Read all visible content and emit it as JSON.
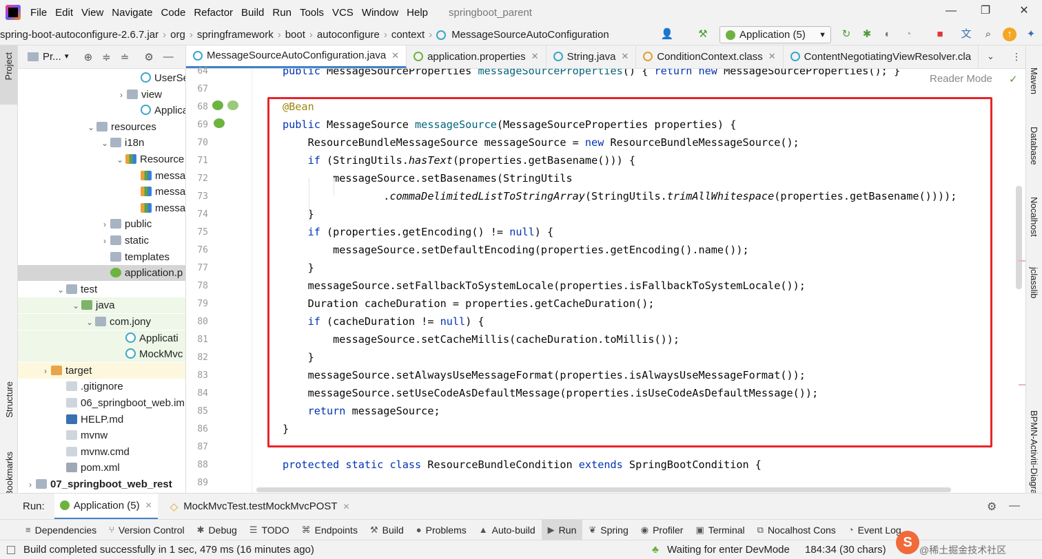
{
  "menubar": {
    "items": [
      "File",
      "Edit",
      "View",
      "Navigate",
      "Code",
      "Refactor",
      "Build",
      "Run",
      "Tools",
      "VCS",
      "Window",
      "Help"
    ],
    "project_title": "springboot_parent"
  },
  "breadcrumb": {
    "items": [
      "spring-boot-autoconfigure-2.6.7.jar",
      "org",
      "springframework",
      "boot",
      "autoconfigure",
      "context",
      "MessageSourceAutoConfiguration"
    ]
  },
  "toolbar": {
    "run_config": "Application (5)"
  },
  "left_strip": {
    "project": "Project",
    "structure": "Structure",
    "bookmarks": "Bookmarks"
  },
  "right_strip": {
    "maven": "Maven",
    "database": "Database",
    "nocalhost": "Nocalhost",
    "jclasslib": "jclasslib",
    "bpmn": "BPMN-Activiti-Diagram"
  },
  "project_panel": {
    "header": "Pr...",
    "tree": [
      {
        "label": "UserSe",
        "indent": 178,
        "icon": "class",
        "arrow": ""
      },
      {
        "label": "view",
        "indent": 158,
        "icon": "folder",
        "arrow": "›"
      },
      {
        "label": "Applicati",
        "indent": 178,
        "icon": "class",
        "arrow": ""
      },
      {
        "label": "resources",
        "indent": 114,
        "icon": "folder",
        "arrow": "⌄"
      },
      {
        "label": "i18n",
        "indent": 134,
        "icon": "folder",
        "arrow": "⌄"
      },
      {
        "label": "Resource",
        "indent": 156,
        "icon": "props",
        "arrow": "⌄"
      },
      {
        "label": "messa",
        "indent": 178,
        "icon": "props",
        "arrow": ""
      },
      {
        "label": "messa",
        "indent": 178,
        "icon": "props",
        "arrow": ""
      },
      {
        "label": "messa",
        "indent": 178,
        "icon": "props",
        "arrow": ""
      },
      {
        "label": "public",
        "indent": 134,
        "icon": "folder",
        "arrow": "›"
      },
      {
        "label": "static",
        "indent": 134,
        "icon": "folder",
        "arrow": "›"
      },
      {
        "label": "templates",
        "indent": 134,
        "icon": "folder",
        "arrow": ""
      },
      {
        "label": "application.p",
        "indent": 134,
        "icon": "spring",
        "arrow": ""
      },
      {
        "label": "test",
        "indent": 70,
        "icon": "folder",
        "arrow": "⌄"
      },
      {
        "label": "java",
        "indent": 92,
        "icon": "greenfolder",
        "arrow": "⌄"
      },
      {
        "label": "com.jony",
        "indent": 112,
        "icon": "folder",
        "arrow": "⌄"
      },
      {
        "label": "Applicati",
        "indent": 156,
        "icon": "class",
        "arrow": ""
      },
      {
        "label": "MockMvc",
        "indent": 156,
        "icon": "class",
        "arrow": ""
      },
      {
        "label": "target",
        "indent": 48,
        "icon": "orangefolder",
        "arrow": "›"
      },
      {
        "label": ".gitignore",
        "indent": 70,
        "icon": "file",
        "arrow": ""
      },
      {
        "label": "06_springboot_web.im",
        "indent": 70,
        "icon": "file",
        "arrow": ""
      },
      {
        "label": "HELP.md",
        "indent": 70,
        "icon": "md",
        "arrow": ""
      },
      {
        "label": "mvnw",
        "indent": 70,
        "icon": "file",
        "arrow": ""
      },
      {
        "label": "mvnw.cmd",
        "indent": 70,
        "icon": "file",
        "arrow": ""
      },
      {
        "label": "pom.xml",
        "indent": 70,
        "icon": "mvn",
        "arrow": ""
      },
      {
        "label": "07_springboot_web_rest",
        "indent": 26,
        "icon": "folder",
        "arrow": "›"
      }
    ]
  },
  "editor_tabs": [
    {
      "label": "MessageSourceAutoConfiguration.java",
      "active": true,
      "color": "#3aa6c8"
    },
    {
      "label": "application.properties",
      "active": false,
      "color": "#6db33f"
    },
    {
      "label": "String.java",
      "active": false,
      "color": "#3aa6c8"
    },
    {
      "label": "ConditionContext.class",
      "active": false,
      "color": "#e0a030"
    },
    {
      "label": "ContentNegotiatingViewResolver.cla",
      "active": false,
      "color": "#3aa6c8"
    }
  ],
  "editor": {
    "reader_mode": "Reader Mode",
    "line_numbers": [
      "64",
      "67",
      "68",
      "69",
      "70",
      "71",
      "72",
      "73",
      "74",
      "75",
      "76",
      "77",
      "78",
      "79",
      "80",
      "81",
      "82",
      "83",
      "84",
      "85",
      "86",
      "87",
      "88",
      "89"
    ],
    "lines": [
      [
        {
          "t": "public ",
          "c": "kw"
        },
        {
          "t": "MessageSourceProperties ",
          "c": ""
        },
        {
          "t": "messageSourceProperties",
          "c": "fn"
        },
        {
          "t": "() { ",
          "c": ""
        },
        {
          "t": "return new ",
          "c": "kw"
        },
        {
          "t": "MessageSourceProperties(); }",
          "c": ""
        }
      ],
      [],
      [
        {
          "t": "@Bean",
          "c": "ann"
        }
      ],
      [
        {
          "t": "public ",
          "c": "kw"
        },
        {
          "t": "MessageSource ",
          "c": ""
        },
        {
          "t": "messageSource",
          "c": "fn"
        },
        {
          "t": "(MessageSourceProperties properties) {",
          "c": ""
        }
      ],
      [
        {
          "t": "    ResourceBundleMessageSource messageSource = ",
          "c": ""
        },
        {
          "t": "new ",
          "c": "kw"
        },
        {
          "t": "ResourceBundleMessageSource();",
          "c": ""
        }
      ],
      [
        {
          "t": "    ",
          "c": ""
        },
        {
          "t": "if ",
          "c": "kw"
        },
        {
          "t": "(StringUtils.",
          "c": ""
        },
        {
          "t": "hasText",
          "c": "it"
        },
        {
          "t": "(properties.getBasename())) {",
          "c": ""
        }
      ],
      [
        {
          "t": "        messageSource.setBasenames(StringUtils",
          "c": ""
        }
      ],
      [
        {
          "t": "                .",
          "c": ""
        },
        {
          "t": "commaDelimitedListToStringArray",
          "c": "it"
        },
        {
          "t": "(StringUtils.",
          "c": ""
        },
        {
          "t": "trimAllWhitespace",
          "c": "it"
        },
        {
          "t": "(properties.getBasename())));",
          "c": ""
        }
      ],
      [
        {
          "t": "    }",
          "c": ""
        }
      ],
      [
        {
          "t": "    ",
          "c": ""
        },
        {
          "t": "if ",
          "c": "kw"
        },
        {
          "t": "(properties.getEncoding() != ",
          "c": ""
        },
        {
          "t": "null",
          "c": "kw"
        },
        {
          "t": ") {",
          "c": ""
        }
      ],
      [
        {
          "t": "        messageSource.setDefaultEncoding(properties.getEncoding().name());",
          "c": ""
        }
      ],
      [
        {
          "t": "    }",
          "c": ""
        }
      ],
      [
        {
          "t": "    messageSource.setFallbackToSystemLocale(properties.isFallbackToSystemLocale());",
          "c": ""
        }
      ],
      [
        {
          "t": "    Duration cacheDuration = properties.getCacheDuration();",
          "c": ""
        }
      ],
      [
        {
          "t": "    ",
          "c": ""
        },
        {
          "t": "if ",
          "c": "kw"
        },
        {
          "t": "(cacheDuration != ",
          "c": ""
        },
        {
          "t": "null",
          "c": "kw"
        },
        {
          "t": ") {",
          "c": ""
        }
      ],
      [
        {
          "t": "        messageSource.setCacheMillis(cacheDuration.toMillis());",
          "c": ""
        }
      ],
      [
        {
          "t": "    }",
          "c": ""
        }
      ],
      [
        {
          "t": "    messageSource.setAlwaysUseMessageFormat(properties.isAlwaysUseMessageFormat());",
          "c": ""
        }
      ],
      [
        {
          "t": "    messageSource.setUseCodeAsDefaultMessage(properties.isUseCodeAsDefaultMessage());",
          "c": ""
        }
      ],
      [
        {
          "t": "    ",
          "c": ""
        },
        {
          "t": "return ",
          "c": "kw"
        },
        {
          "t": "messageSource;",
          "c": ""
        }
      ],
      [
        {
          "t": "}",
          "c": ""
        }
      ],
      [],
      [
        {
          "t": "protected static class ",
          "c": "kw"
        },
        {
          "t": "ResourceBundleCondition ",
          "c": ""
        },
        {
          "t": "extends ",
          "c": "kw"
        },
        {
          "t": "SpringBootCondition {",
          "c": ""
        }
      ],
      []
    ]
  },
  "run_bar": {
    "label": "Run:",
    "tabs": [
      "Application (5)",
      "MockMvcTest.testMockMvcPOST"
    ]
  },
  "tool_windows": [
    "Dependencies",
    "Version Control",
    "Debug",
    "TODO",
    "Endpoints",
    "Build",
    "Problems",
    "Auto-build",
    "Run",
    "Spring",
    "Profiler",
    "Terminal",
    "Nocalhost Cons",
    "Event Log"
  ],
  "status": {
    "message": "Build completed successfully in 1 sec, 479 ms (16 minutes ago)",
    "devmode": "Waiting for enter DevMode",
    "position": "184:34 (30 chars)",
    "watermark": "@稀土掘金技术社区"
  }
}
